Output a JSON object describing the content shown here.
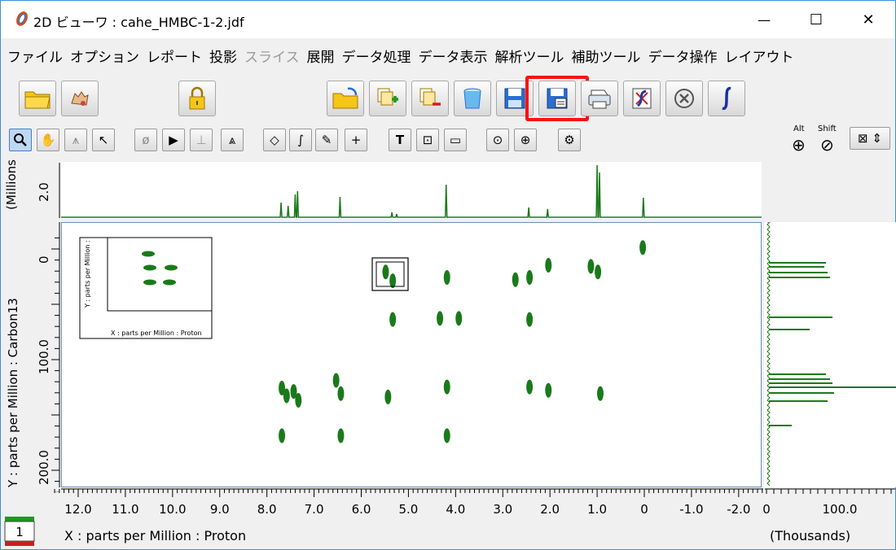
{
  "window": {
    "title": "2D ビューワ : cahe_HMBC-1-2.jdf",
    "minimize": "—",
    "maximize": "☐",
    "close": "✕"
  },
  "menu": [
    {
      "label": "ファイル",
      "disabled": false
    },
    {
      "label": "オプション",
      "disabled": false
    },
    {
      "label": "レポート",
      "disabled": false
    },
    {
      "label": "投影",
      "disabled": false
    },
    {
      "label": "スライス",
      "disabled": true
    },
    {
      "label": "展開",
      "disabled": false
    },
    {
      "label": "データ処理",
      "disabled": false
    },
    {
      "label": "データ表示",
      "disabled": false
    },
    {
      "label": "解析ツール",
      "disabled": false
    },
    {
      "label": "補助ツール",
      "disabled": false
    },
    {
      "label": "データ操作",
      "disabled": false
    },
    {
      "label": "レイアウト",
      "disabled": false
    }
  ],
  "toolbar2": {
    "alt_label": "Alt",
    "shift_label": "Shift"
  },
  "plot": {
    "x_axis_label": "X : parts per Million : Proton",
    "y_axis_label": "Y : parts per Million : Carbon13",
    "top_axis_label": "(Millions)",
    "right_axis_label": "(Thousands)",
    "inset_x_label": "X : parts per Million : Proton",
    "inset_y_label": "Y : parts per Million :",
    "page_number": "1",
    "colors": {
      "contour": "#1a7a1a",
      "highlight": "#ff1010"
    }
  },
  "chart_data": {
    "type": "scatter",
    "title": "",
    "xlabel": "X : parts per Million : Proton",
    "ylabel": "Y : parts per Million : Carbon13",
    "xlim": [
      12.5,
      -2.5
    ],
    "ylim": [
      225,
      -12
    ],
    "x_ticks": [
      "12.0",
      "11.0",
      "10.0",
      "9.0",
      "8.0",
      "7.0",
      "6.0",
      "5.0",
      "4.0",
      "3.0",
      "2.0",
      "1.0",
      "0",
      "-1.0",
      "-2.0"
    ],
    "y_ticks": [
      "0",
      "100.0",
      "200.0"
    ],
    "top_ticks": [
      "2.0"
    ],
    "right_ticks": [
      "0",
      "100.0"
    ],
    "peaks": [
      {
        "x": 7.7,
        "y": 125
      },
      {
        "x": 7.6,
        "y": 132
      },
      {
        "x": 7.45,
        "y": 128
      },
      {
        "x": 7.35,
        "y": 136
      },
      {
        "x": 7.7,
        "y": 168
      },
      {
        "x": 6.45,
        "y": 130
      },
      {
        "x": 6.45,
        "y": 168
      },
      {
        "x": 6.55,
        "y": 118
      },
      {
        "x": 5.45,
        "y": 133
      },
      {
        "x": 5.35,
        "y": 63
      },
      {
        "x": 4.2,
        "y": 124
      },
      {
        "x": 4.2,
        "y": 168
      },
      {
        "x": 4.2,
        "y": 25
      },
      {
        "x": 4.35,
        "y": 62
      },
      {
        "x": 3.95,
        "y": 62
      },
      {
        "x": 2.45,
        "y": 63
      },
      {
        "x": 2.45,
        "y": 124
      },
      {
        "x": 2.05,
        "y": 127
      },
      {
        "x": 2.45,
        "y": 25
      },
      {
        "x": 2.05,
        "y": 14
      },
      {
        "x": 1.0,
        "y": 20
      },
      {
        "x": 0.95,
        "y": 130
      },
      {
        "x": 1.15,
        "y": 15
      },
      {
        "x": 0.05,
        "y": -2
      },
      {
        "x": 2.75,
        "y": 27
      },
      {
        "x": 5.5,
        "y": 20
      },
      {
        "x": 5.35,
        "y": 28
      }
    ]
  }
}
